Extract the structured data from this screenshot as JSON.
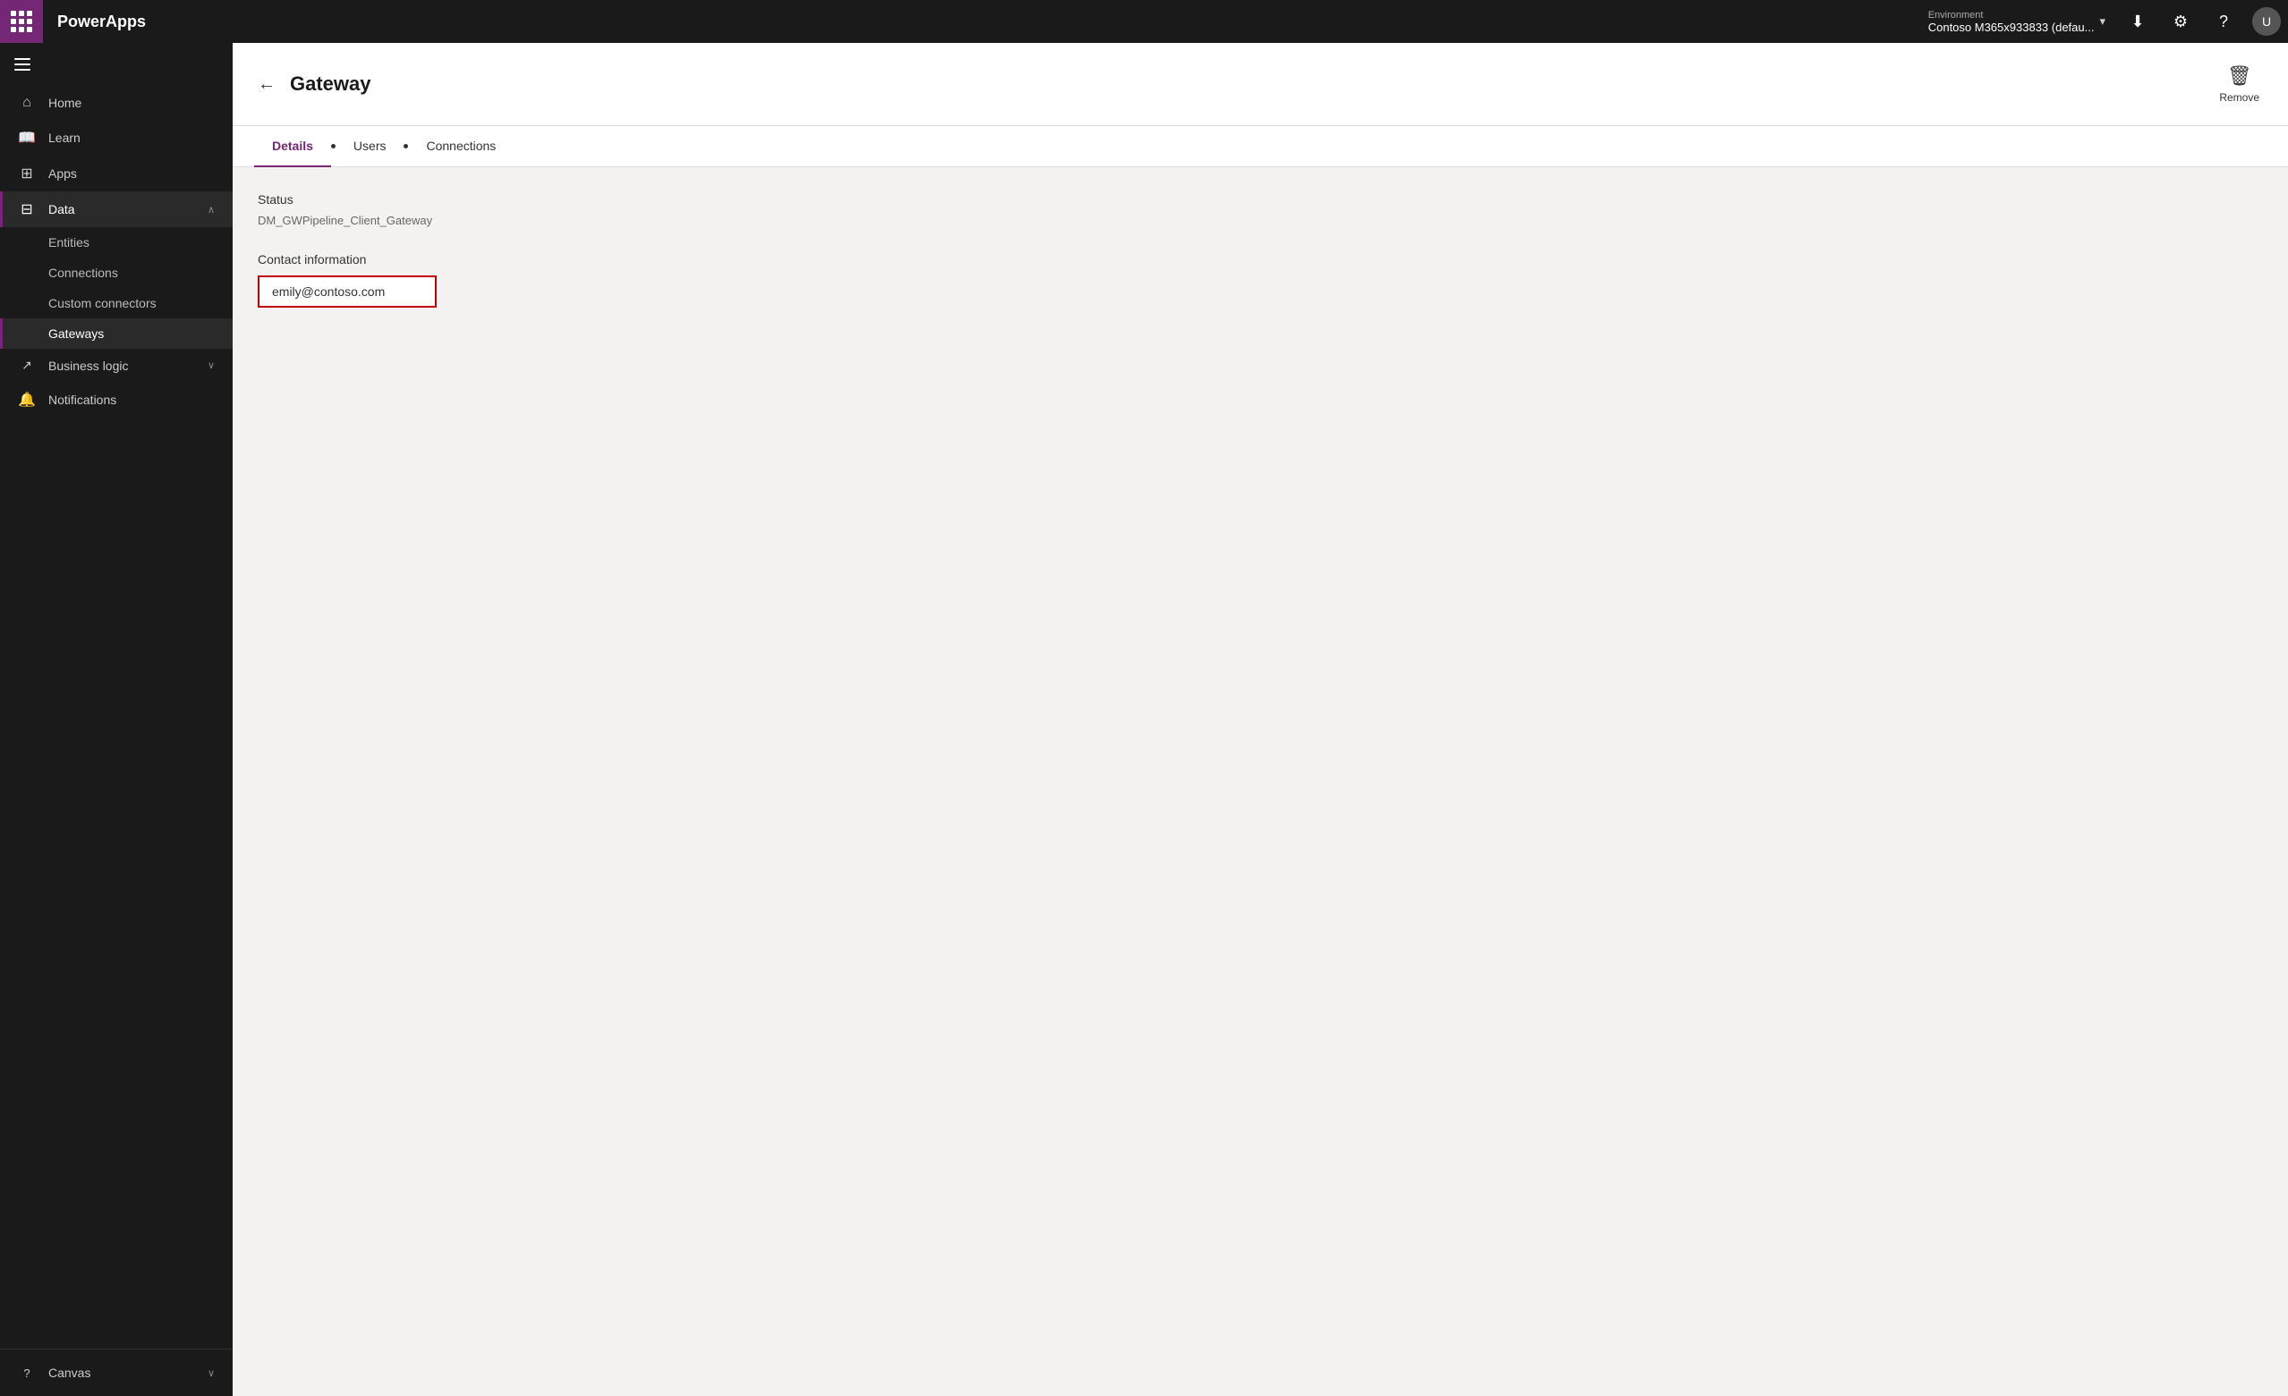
{
  "topbar": {
    "logo": "PowerApps",
    "environment_label": "Environment",
    "environment_value": "Contoso M365x933833 (defau...",
    "download_icon": "⬇",
    "settings_icon": "⚙",
    "help_icon": "?",
    "avatar_label": "U"
  },
  "sidebar": {
    "items": [
      {
        "id": "home",
        "label": "Home",
        "icon": "🏠",
        "active": false
      },
      {
        "id": "learn",
        "label": "Learn",
        "icon": "📖",
        "active": false
      },
      {
        "id": "apps",
        "label": "Apps",
        "icon": "⊞",
        "active": false
      },
      {
        "id": "data",
        "label": "Data",
        "icon": "⊟",
        "active": true,
        "chevron": "∧",
        "expanded": true
      }
    ],
    "sub_items": [
      {
        "id": "entities",
        "label": "Entities",
        "active": false
      },
      {
        "id": "connections",
        "label": "Connections",
        "active": false
      },
      {
        "id": "custom-connectors",
        "label": "Custom connectors",
        "active": false
      },
      {
        "id": "gateways",
        "label": "Gateways",
        "active": true
      }
    ],
    "bottom_items": [
      {
        "id": "business-logic",
        "label": "Business logic",
        "icon": "↗",
        "chevron": "∨",
        "active": false
      },
      {
        "id": "notifications",
        "label": "Notifications",
        "icon": "🔔",
        "active": false
      }
    ],
    "footer_items": [
      {
        "id": "canvas",
        "label": "Canvas",
        "icon": "?",
        "chevron": "∨"
      }
    ]
  },
  "page": {
    "title": "Gateway",
    "remove_label": "Remove"
  },
  "tabs": [
    {
      "id": "details",
      "label": "Details",
      "active": true
    },
    {
      "id": "users",
      "label": "Users",
      "active": false
    },
    {
      "id": "connections",
      "label": "Connections",
      "active": false
    }
  ],
  "details": {
    "status_label": "Status",
    "status_value": "DM_GWPipeline_Client_Gateway",
    "contact_label": "Contact information",
    "contact_value": "emily@contoso.com"
  }
}
